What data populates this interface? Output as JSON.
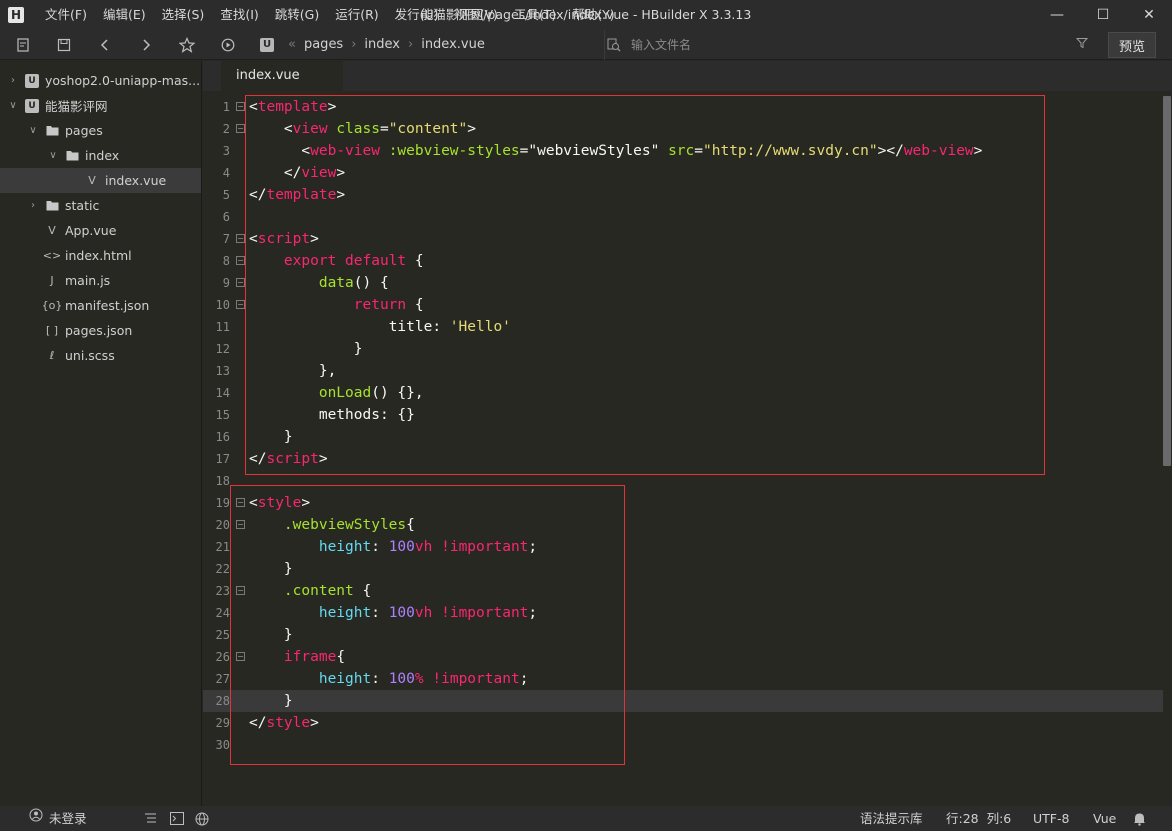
{
  "app": {
    "logo": "H",
    "window_title": "能猫影评网/pages/index/index.vue - HBuilder X 3.3.13"
  },
  "menu": [
    "文件(F)",
    "编辑(E)",
    "选择(S)",
    "查找(I)",
    "跳转(G)",
    "运行(R)",
    "发行(U)",
    "视图(V)",
    "工具(T)",
    "帮助(Y)"
  ],
  "window_controls": {
    "minimize": "—",
    "maximize": "☐",
    "close": "✕"
  },
  "toolbar": {
    "icons": [
      "new-file-icon",
      "save-icon",
      "back-icon",
      "forward-icon",
      "star-icon",
      "run-icon"
    ],
    "breadcrumb_logo": "U",
    "breadcrumb": [
      "pages",
      "index",
      "index.vue"
    ],
    "file_search_placeholder": "输入文件名",
    "preview_label": "预览"
  },
  "sidebar": {
    "items": [
      {
        "label": "yoshop2.0-uniapp-mas...",
        "level": 0,
        "chevron": "›",
        "icon": "U",
        "icon_type": "proj"
      },
      {
        "label": "能猫影评网",
        "level": 0,
        "chevron": "⌄",
        "icon": "U",
        "icon_type": "proj"
      },
      {
        "label": "pages",
        "level": 1,
        "chevron": "⌄",
        "icon": "▆",
        "icon_type": "folder"
      },
      {
        "label": "index",
        "level": 2,
        "chevron": "⌄",
        "icon": "▆",
        "icon_type": "folder"
      },
      {
        "label": "index.vue",
        "level": 3,
        "chevron": "",
        "icon": "V",
        "icon_type": "file",
        "selected": true
      },
      {
        "label": "static",
        "level": 1,
        "chevron": "›",
        "icon": "▆",
        "icon_type": "folder"
      },
      {
        "label": "App.vue",
        "level": 1,
        "chevron": "",
        "icon": "V",
        "icon_type": "file"
      },
      {
        "label": "index.html",
        "level": 1,
        "chevron": "",
        "icon": "<>",
        "icon_type": "file"
      },
      {
        "label": "main.js",
        "level": 1,
        "chevron": "",
        "icon": "J",
        "icon_type": "file"
      },
      {
        "label": "manifest.json",
        "level": 1,
        "chevron": "",
        "icon": "{o}",
        "icon_type": "file"
      },
      {
        "label": "pages.json",
        "level": 1,
        "chevron": "",
        "icon": "[ ]",
        "icon_type": "file"
      },
      {
        "label": "uni.scss",
        "level": 1,
        "chevron": "",
        "icon": "ℓ",
        "icon_type": "file"
      }
    ]
  },
  "editor": {
    "tab": "index.vue",
    "active_line": 28,
    "lines": [
      {
        "n": "1",
        "fold": true,
        "html": "<span class=\"w\">&lt;</span><span class=\"t\">template</span><span class=\"w\">&gt;</span>"
      },
      {
        "n": "2",
        "fold": true,
        "html": "    <span class=\"w\">&lt;</span><span class=\"t\">view</span> <span class=\"a\">class</span><span class=\"w\">=</span><span class=\"s\">\"content\"</span><span class=\"w\">&gt;</span>"
      },
      {
        "n": "3",
        "fold": false,
        "html": "      <span class=\"w\">&lt;</span><span class=\"t\">web-view</span> <span class=\"a\">:webview-styles</span><span class=\"w\">=</span><span class=\"w\">\"webviewStyles\"</span> <span class=\"a\">src</span><span class=\"w\">=</span><span class=\"s\">\"http://www.svdy.cn\"</span><span class=\"w\">&gt;&lt;/</span><span class=\"t\">web-view</span><span class=\"w\">&gt;</span>"
      },
      {
        "n": "4",
        "fold": false,
        "html": "    <span class=\"w\">&lt;/</span><span class=\"t\">view</span><span class=\"w\">&gt;</span>"
      },
      {
        "n": "5",
        "fold": false,
        "html": "<span class=\"w\">&lt;/</span><span class=\"t\">template</span><span class=\"w\">&gt;</span>"
      },
      {
        "n": "6",
        "fold": false,
        "html": ""
      },
      {
        "n": "7",
        "fold": true,
        "html": "<span class=\"w\">&lt;</span><span class=\"t\">script</span><span class=\"w\">&gt;</span>"
      },
      {
        "n": "8",
        "fold": true,
        "html": "    <span class=\"k\">export</span> <span class=\"k\">default</span> <span class=\"w\">{</span>"
      },
      {
        "n": "9",
        "fold": true,
        "html": "        <span class=\"f\">data</span><span class=\"w\">() {</span>"
      },
      {
        "n": "10",
        "fold": true,
        "html": "            <span class=\"k\">return</span> <span class=\"w\">{</span>"
      },
      {
        "n": "11",
        "fold": false,
        "html": "                <span class=\"w\">title: </span><span class=\"s\">'Hello'</span>"
      },
      {
        "n": "12",
        "fold": false,
        "html": "            <span class=\"w\">}</span>"
      },
      {
        "n": "13",
        "fold": false,
        "html": "        <span class=\"w\">},</span>"
      },
      {
        "n": "14",
        "fold": false,
        "html": "        <span class=\"f\">onLoad</span><span class=\"w\">() {},</span>"
      },
      {
        "n": "15",
        "fold": false,
        "html": "        <span class=\"w\">methods: {}</span>"
      },
      {
        "n": "16",
        "fold": false,
        "html": "    <span class=\"w\">}</span>"
      },
      {
        "n": "17",
        "fold": false,
        "html": "<span class=\"w\">&lt;/</span><span class=\"t\">script</span><span class=\"w\">&gt;</span>"
      },
      {
        "n": "18",
        "fold": false,
        "html": ""
      },
      {
        "n": "19",
        "fold": true,
        "html": "<span class=\"w\">&lt;</span><span class=\"t\">style</span><span class=\"w\">&gt;</span>"
      },
      {
        "n": "20",
        "fold": true,
        "html": "    <span class=\"c\">.webviewStyles</span><span class=\"w\">{</span>"
      },
      {
        "n": "21",
        "fold": false,
        "html": "        <span class=\"prop\">height</span><span class=\"w\">: </span><span class=\"n\">100</span><span class=\"u\">vh</span> <span class=\"u\">!important</span><span class=\"w\">;</span>"
      },
      {
        "n": "22",
        "fold": false,
        "html": "    <span class=\"w\">}</span>"
      },
      {
        "n": "23",
        "fold": true,
        "html": "    <span class=\"c\">.content</span> <span class=\"w\">{</span>"
      },
      {
        "n": "24",
        "fold": false,
        "html": "        <span class=\"prop\">height</span><span class=\"w\">: </span><span class=\"n\">100</span><span class=\"u\">vh</span> <span class=\"u\">!important</span><span class=\"w\">;</span>"
      },
      {
        "n": "25",
        "fold": false,
        "html": "    <span class=\"w\">}</span>"
      },
      {
        "n": "26",
        "fold": true,
        "html": "    <span class=\"t\">iframe</span><span class=\"w\">{</span>"
      },
      {
        "n": "27",
        "fold": false,
        "html": "        <span class=\"prop\">height</span><span class=\"w\">: </span><span class=\"n\">100</span><span class=\"u\">%</span> <span class=\"u\">!important</span><span class=\"w\">;</span>"
      },
      {
        "n": "28",
        "fold": false,
        "html": "    <span class=\"w\">}</span>"
      },
      {
        "n": "29",
        "fold": false,
        "html": "<span class=\"w\">&lt;/</span><span class=\"t\">style</span><span class=\"w\">&gt;</span>"
      },
      {
        "n": "30",
        "fold": false,
        "html": ""
      }
    ]
  },
  "statusbar": {
    "login": "未登录",
    "syntax_lib": "语法提示库",
    "position": "行:28  列:6",
    "encoding": "UTF-8",
    "language": "Vue"
  }
}
